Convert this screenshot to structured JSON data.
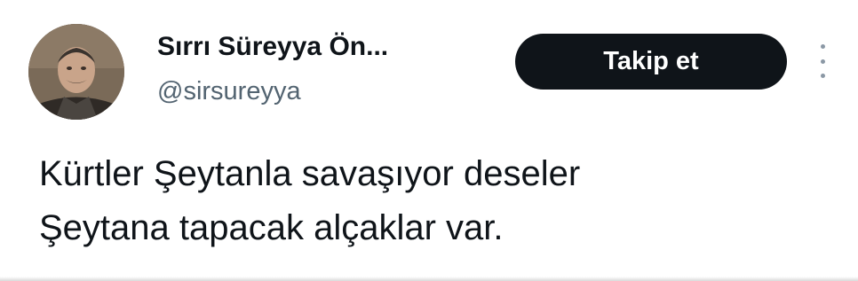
{
  "tweet": {
    "author": {
      "display_name": "Sırrı Süreyya Ön...",
      "handle": "@sirsureyya"
    },
    "follow_label": "Takip et",
    "text_lines": [
      "Kürtler Şeytanla savaşıyor deseler",
      "Şeytana tapacak alçaklar var."
    ]
  },
  "icons": {
    "more": "more-vertical-icon",
    "avatar": "avatar-photo"
  },
  "colors": {
    "text_primary": "#0f1419",
    "text_secondary": "#536471",
    "button_bg": "#0f1419",
    "button_text": "#ffffff"
  }
}
